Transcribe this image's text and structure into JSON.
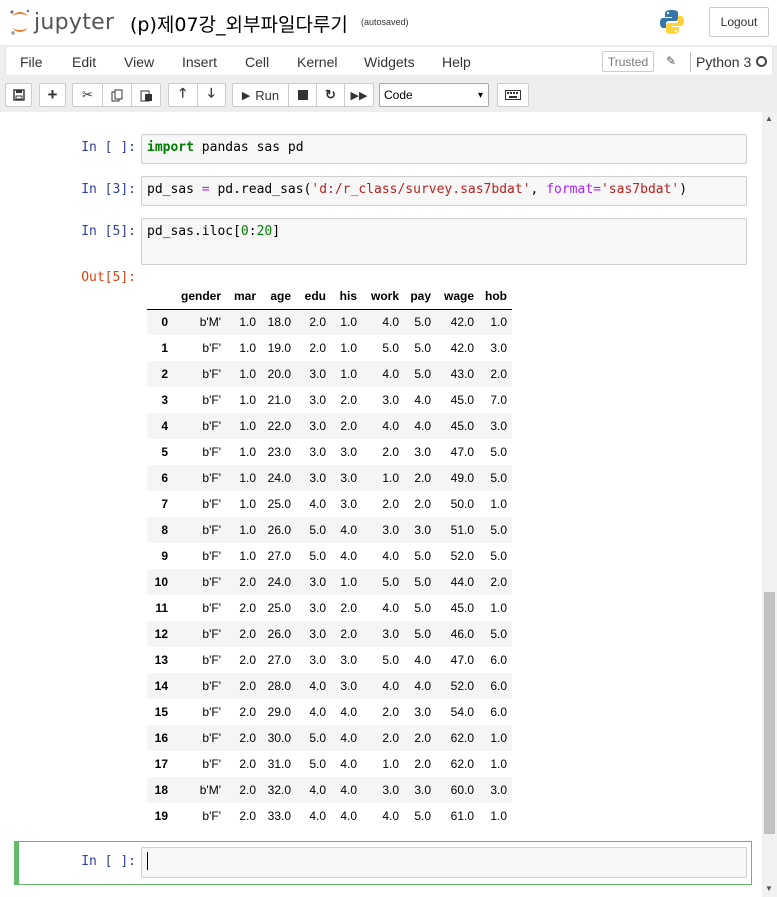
{
  "header": {
    "logo_text": "jupyter",
    "notebook_title": "(p)제07강_외부파일다루기",
    "autosave": "(autosaved)",
    "logout_label": "Logout"
  },
  "menubar": {
    "items": [
      "File",
      "Edit",
      "View",
      "Insert",
      "Cell",
      "Kernel",
      "Widgets",
      "Help"
    ],
    "trusted_label": "Trusted",
    "kernel_name": "Python 3"
  },
  "toolbar": {
    "run_label": "Run",
    "cell_type": "Code"
  },
  "cells": [
    {
      "prompt": "In [ ]:",
      "code": "import pandas sas pd"
    },
    {
      "prompt": "In [3]:",
      "code": "pd_sas = pd.read_sas('d:/r_class/survey.sas7bdat', format='sas7bdat')"
    },
    {
      "prompt": "In [5]:",
      "code": "pd_sas.iloc[0:20]"
    },
    {
      "prompt": "In [ ]:",
      "code": ""
    }
  ],
  "output": {
    "prompt": "Out[5]:",
    "columns": [
      "gender",
      "mar",
      "age",
      "edu",
      "his",
      "work",
      "pay",
      "wage",
      "hob"
    ],
    "rows": [
      [
        "0",
        "b'M'",
        "1.0",
        "18.0",
        "2.0",
        "1.0",
        "4.0",
        "5.0",
        "42.0",
        "1.0"
      ],
      [
        "1",
        "b'F'",
        "1.0",
        "19.0",
        "2.0",
        "1.0",
        "5.0",
        "5.0",
        "42.0",
        "3.0"
      ],
      [
        "2",
        "b'F'",
        "1.0",
        "20.0",
        "3.0",
        "1.0",
        "4.0",
        "5.0",
        "43.0",
        "2.0"
      ],
      [
        "3",
        "b'F'",
        "1.0",
        "21.0",
        "3.0",
        "2.0",
        "3.0",
        "4.0",
        "45.0",
        "7.0"
      ],
      [
        "4",
        "b'F'",
        "1.0",
        "22.0",
        "3.0",
        "2.0",
        "4.0",
        "4.0",
        "45.0",
        "3.0"
      ],
      [
        "5",
        "b'F'",
        "1.0",
        "23.0",
        "3.0",
        "3.0",
        "2.0",
        "3.0",
        "47.0",
        "5.0"
      ],
      [
        "6",
        "b'F'",
        "1.0",
        "24.0",
        "3.0",
        "3.0",
        "1.0",
        "2.0",
        "49.0",
        "5.0"
      ],
      [
        "7",
        "b'F'",
        "1.0",
        "25.0",
        "4.0",
        "3.0",
        "2.0",
        "2.0",
        "50.0",
        "1.0"
      ],
      [
        "8",
        "b'F'",
        "1.0",
        "26.0",
        "5.0",
        "4.0",
        "3.0",
        "3.0",
        "51.0",
        "5.0"
      ],
      [
        "9",
        "b'F'",
        "1.0",
        "27.0",
        "5.0",
        "4.0",
        "4.0",
        "5.0",
        "52.0",
        "5.0"
      ],
      [
        "10",
        "b'F'",
        "2.0",
        "24.0",
        "3.0",
        "1.0",
        "5.0",
        "5.0",
        "44.0",
        "2.0"
      ],
      [
        "11",
        "b'F'",
        "2.0",
        "25.0",
        "3.0",
        "2.0",
        "4.0",
        "5.0",
        "45.0",
        "1.0"
      ],
      [
        "12",
        "b'F'",
        "2.0",
        "26.0",
        "3.0",
        "2.0",
        "3.0",
        "5.0",
        "46.0",
        "5.0"
      ],
      [
        "13",
        "b'F'",
        "2.0",
        "27.0",
        "3.0",
        "3.0",
        "5.0",
        "4.0",
        "47.0",
        "6.0"
      ],
      [
        "14",
        "b'F'",
        "2.0",
        "28.0",
        "4.0",
        "3.0",
        "4.0",
        "4.0",
        "52.0",
        "6.0"
      ],
      [
        "15",
        "b'F'",
        "2.0",
        "29.0",
        "4.0",
        "4.0",
        "2.0",
        "3.0",
        "54.0",
        "6.0"
      ],
      [
        "16",
        "b'F'",
        "2.0",
        "30.0",
        "5.0",
        "4.0",
        "2.0",
        "2.0",
        "62.0",
        "1.0"
      ],
      [
        "17",
        "b'F'",
        "2.0",
        "31.0",
        "5.0",
        "4.0",
        "1.0",
        "2.0",
        "62.0",
        "1.0"
      ],
      [
        "18",
        "b'M'",
        "2.0",
        "32.0",
        "4.0",
        "4.0",
        "3.0",
        "3.0",
        "60.0",
        "3.0"
      ],
      [
        "19",
        "b'F'",
        "2.0",
        "33.0",
        "4.0",
        "4.0",
        "4.0",
        "5.0",
        "61.0",
        "1.0"
      ]
    ]
  },
  "colors": {
    "in_prompt": "#303f9f",
    "out_prompt": "#d84315",
    "active_cell_border": "#66bb6a"
  }
}
